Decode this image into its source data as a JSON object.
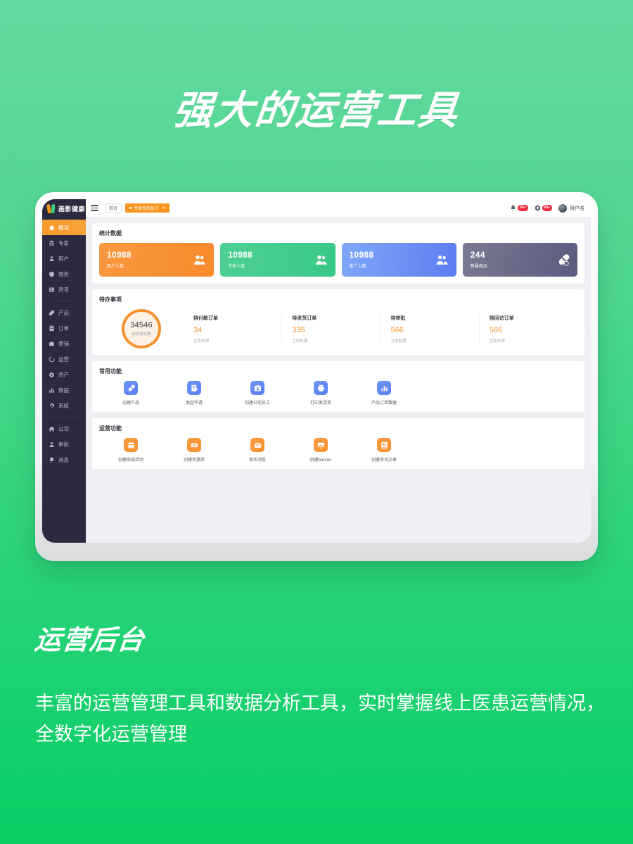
{
  "hero": {
    "title": "强大的运营工具",
    "sub_title": "运营后台",
    "body_copy": "丰富的运营管理工具和数据分析工具，实时掌握线上医患运营情况，全数字化运营管理"
  },
  "app": {
    "brand": "画影健康",
    "topbar": {
      "menu_icon": "hamburger-icon",
      "tabs": [
        {
          "label": "首页",
          "active": false,
          "closable": false
        },
        {
          "label": "专家常用处方",
          "active": true,
          "closable": true,
          "close": "✕"
        }
      ],
      "bell_badge": "99+",
      "help_badge": "99+",
      "user_name": "用户名"
    },
    "sidebar": {
      "groups": [
        {
          "items": [
            {
              "label": "概况",
              "icon": "home-icon",
              "active": true
            },
            {
              "label": "专家",
              "icon": "expert-icon",
              "active": false
            },
            {
              "label": "用户",
              "icon": "user-icon",
              "active": false
            },
            {
              "label": "服务",
              "icon": "shield-icon",
              "active": false
            },
            {
              "label": "资讯",
              "icon": "news-icon",
              "active": false
            }
          ]
        },
        {
          "items": [
            {
              "label": "产品",
              "icon": "product-icon",
              "active": false
            },
            {
              "label": "订单",
              "icon": "order-icon",
              "active": false
            },
            {
              "label": "营销",
              "icon": "marketing-icon",
              "active": false
            },
            {
              "label": "运营",
              "icon": "operation-icon",
              "active": false
            },
            {
              "label": "资产",
              "icon": "asset-icon",
              "active": false
            },
            {
              "label": "数据",
              "icon": "data-icon",
              "active": false
            },
            {
              "label": "系统",
              "icon": "system-icon",
              "active": false
            }
          ]
        },
        {
          "items": [
            {
              "label": "公司",
              "icon": "company-icon",
              "active": false
            },
            {
              "label": "审批",
              "icon": "approval-icon",
              "active": false
            },
            {
              "label": "消息",
              "icon": "message-icon",
              "active": false
            }
          ]
        }
      ]
    },
    "sections": {
      "stats": {
        "title": "统计数据",
        "cards": [
          {
            "value": "10988",
            "label": "用户人数",
            "icon": "users-icon",
            "color": "#f8902f"
          },
          {
            "value": "10988",
            "label": "专家人数",
            "icon": "users-icon",
            "color": "#3ec885"
          },
          {
            "value": "10988",
            "label": "推广人数",
            "icon": "users-group-icon",
            "color": "#5b7df2"
          },
          {
            "value": "244",
            "label": "售罄商品",
            "icon": "pill-icon",
            "color": "#5b5b7e"
          }
        ]
      },
      "todo": {
        "title": "待办事项",
        "ring": {
          "value": "34546",
          "label": "待处理总数"
        },
        "items": [
          {
            "title": "待付款订单",
            "value": "34",
            "action": "立即处理"
          },
          {
            "title": "待发货订单",
            "value": "335",
            "action": "立即处理"
          },
          {
            "title": "待审批",
            "value": "566",
            "action": "立即处理"
          },
          {
            "title": "待回访订单",
            "value": "566",
            "action": "立即处理"
          }
        ]
      },
      "common": {
        "title": "常用功能",
        "items": [
          {
            "label": "创建产品",
            "icon": "pill-create-icon"
          },
          {
            "label": "发起申请",
            "icon": "apply-icon"
          },
          {
            "label": "创建公司员工",
            "icon": "employee-icon"
          },
          {
            "label": "打印发货单",
            "icon": "printer-icon"
          },
          {
            "label": "产品订单数据",
            "icon": "bar-chart-icon"
          }
        ]
      },
      "operation": {
        "title": "运营功能",
        "items": [
          {
            "label": "创建商城活动",
            "icon": "calendar-icon"
          },
          {
            "label": "创建优惠券",
            "icon": "coupon-icon"
          },
          {
            "label": "发布消息",
            "icon": "envelope-icon"
          },
          {
            "label": "创建banner",
            "icon": "image-icon"
          },
          {
            "label": "创建资讯文章",
            "icon": "article-icon"
          }
        ]
      }
    }
  }
}
